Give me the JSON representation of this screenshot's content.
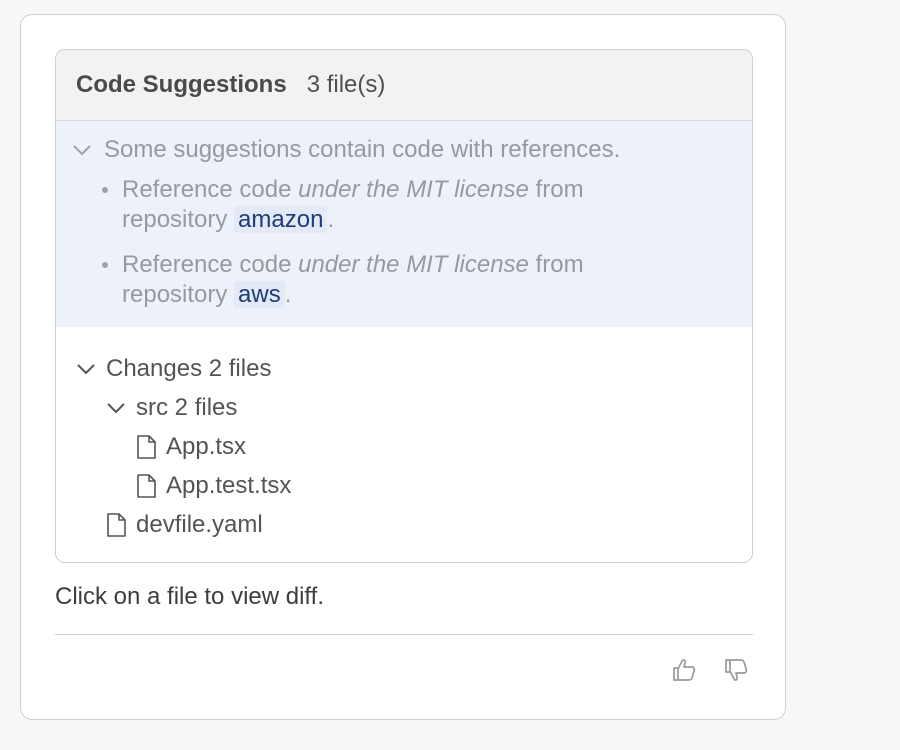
{
  "header": {
    "title": "Code Suggestions",
    "count": "3 file(s)"
  },
  "references": {
    "summary": "Some suggestions contain code with references.",
    "items": [
      {
        "prefix": "Reference code ",
        "license": "under the MIT license",
        "middle": " from repository ",
        "repo": "amazon",
        "suffix": "."
      },
      {
        "prefix": "Reference code ",
        "license": "under the MIT license",
        "middle": " from repository ",
        "repo": "aws",
        "suffix": "."
      }
    ]
  },
  "tree": {
    "root": {
      "label": "Changes",
      "count": "2 files"
    },
    "folder": {
      "label": "src",
      "count": "2 files"
    },
    "files": [
      "App.tsx",
      "App.test.tsx"
    ],
    "root_file": "devfile.yaml"
  },
  "hint": "Click on a file to view diff.",
  "icons": {
    "chevron": "chevron-down-icon",
    "file": "file-icon",
    "thumbs_up": "thumbs-up-icon",
    "thumbs_down": "thumbs-down-icon"
  },
  "colors": {
    "references_bg": "#edf2fa",
    "repo_link": "#1d3a7a"
  }
}
